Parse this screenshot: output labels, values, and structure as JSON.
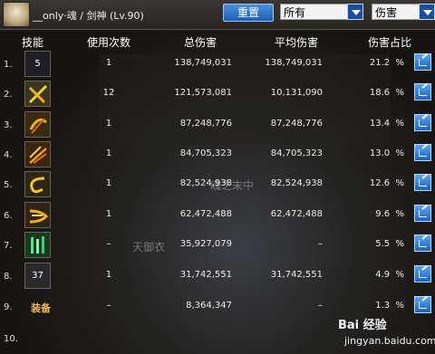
{
  "header": {
    "character": "__only·魂 / 剑神 (Lv.90)",
    "reset_label": "重置",
    "filter_select": "所有",
    "sort_select": "伤害"
  },
  "columns": {
    "skill": "技能",
    "count": "使用次数",
    "total": "总伤害",
    "avg": "平均伤害",
    "pct": "伤害占比"
  },
  "rows": [
    {
      "idx": "1.",
      "icon_text": "5",
      "count": "1",
      "total": "138,749,031",
      "avg": "138,749,031",
      "pct": "21.2  %"
    },
    {
      "idx": "2.",
      "icon_text": "",
      "count": "12",
      "total": "121,573,081",
      "avg": "10,131,090",
      "pct": "18.6  %"
    },
    {
      "idx": "3.",
      "icon_text": "",
      "count": "1",
      "total": "87,248,776",
      "avg": "87,248,776",
      "pct": "13.4  %"
    },
    {
      "idx": "4.",
      "icon_text": "",
      "count": "1",
      "total": "84,705,323",
      "avg": "84,705,323",
      "pct": "13.0  %"
    },
    {
      "idx": "5.",
      "icon_text": "",
      "count": "1",
      "total": "82,524,938",
      "avg": "82,524,938",
      "pct": "12.6  %"
    },
    {
      "idx": "6.",
      "icon_text": "",
      "count": "1",
      "total": "62,472,488",
      "avg": "62,472,488",
      "pct": "9.6  %"
    },
    {
      "idx": "7.",
      "icon_text": "",
      "count": "–",
      "total": "35,927,079",
      "avg": "–",
      "pct": "5.5  %"
    },
    {
      "idx": "8.",
      "icon_text": "37",
      "count": "1",
      "total": "31,742,551",
      "avg": "31,742,551",
      "pct": "4.9  %"
    },
    {
      "idx": "9.",
      "icon_text": "装备",
      "count": "–",
      "total": "8,364,347",
      "avg": "–",
      "pct": "1.3  %"
    },
    {
      "idx": "10.",
      "icon_text": "",
      "count": "",
      "total": "",
      "avg": "",
      "pct": ""
    }
  ],
  "watermark": {
    "brand": "Bai 经验",
    "url": "jingyan.baidu.com"
  },
  "icons": [
    "skill-dark-icon",
    "skill-cross-slash-icon",
    "skill-crescent-icon",
    "skill-blades-icon",
    "skill-swirl-icon",
    "skill-wave-icon",
    "skill-green-pillar-icon",
    "skill-gray-icon",
    "equipment-label",
    "empty"
  ]
}
